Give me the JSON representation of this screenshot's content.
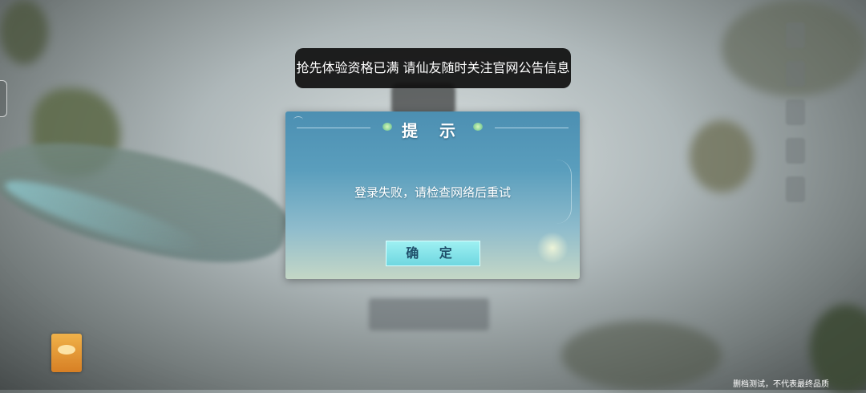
{
  "toast": {
    "message": "抢先体验资格已满 请仙友随时关注官网公告信息"
  },
  "dialog": {
    "title": "提 示",
    "message": "登录失败，请检查网络后重试",
    "confirm_label": "确 定"
  },
  "footer": {
    "note": "删档测试，不代表最终品质"
  },
  "colors": {
    "dialog_top": "#4c8fb2",
    "dialog_bottom": "#c4d7c6",
    "button": "#7fe0e8",
    "toast_bg": "#0f0f0f"
  }
}
